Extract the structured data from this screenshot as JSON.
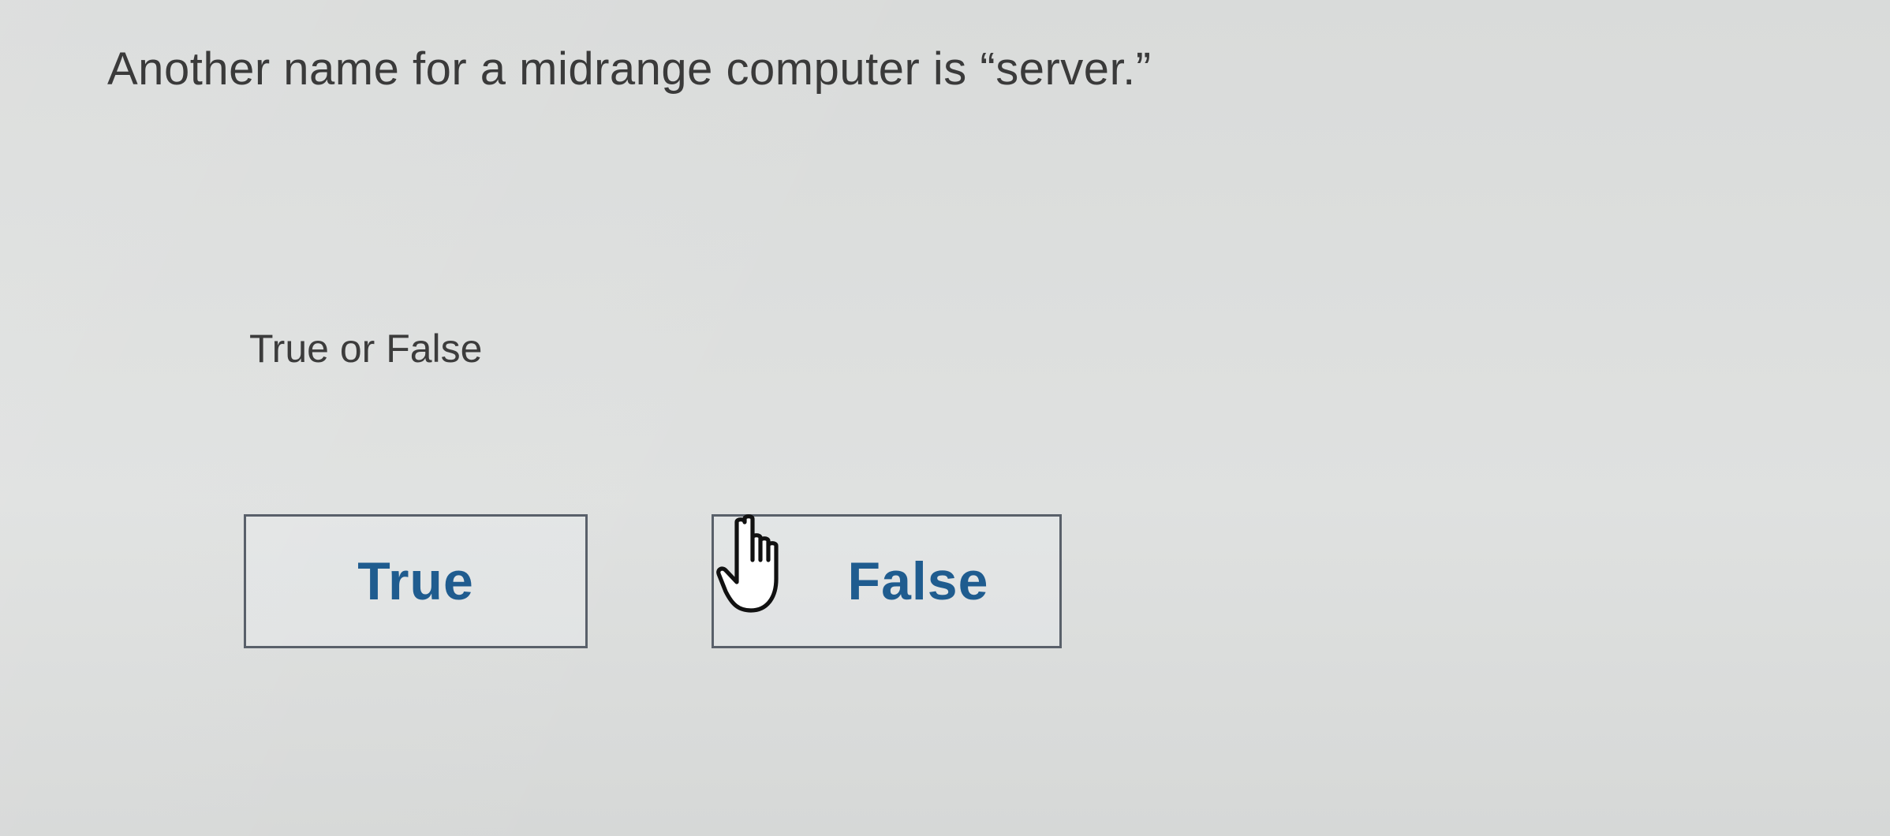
{
  "question": {
    "text": "Another name for a midrange computer is “server.”"
  },
  "prompt": {
    "text": "True or False"
  },
  "answers": [
    {
      "label": "True"
    },
    {
      "label": "False"
    }
  ],
  "cursor": {
    "icon": "hand-pointer-icon"
  },
  "colors": {
    "answer_text": "#1f5c8f",
    "answer_border": "#59606a",
    "body_text": "#3a3a3a"
  }
}
